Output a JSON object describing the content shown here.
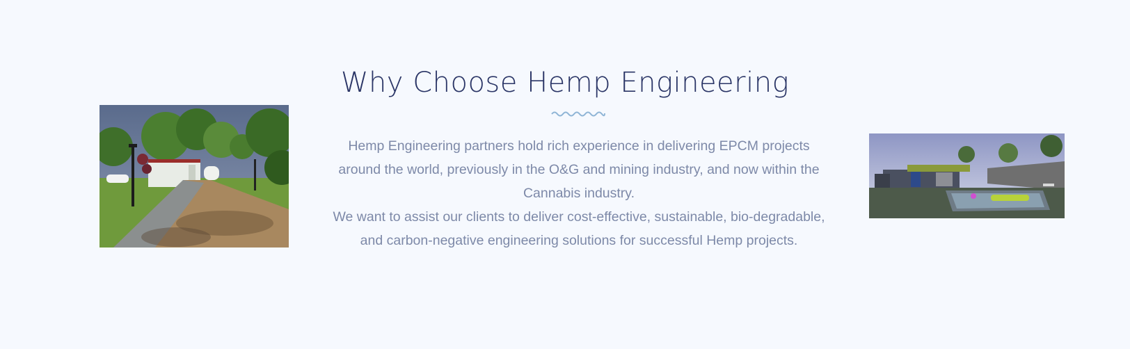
{
  "section": {
    "heading": "Why Choose Hemp Engineering",
    "paragraph_1": "Hemp Engineering partners hold rich experience in delivering EPCM projects around the world, previously in the O&G and mining industry, and now within the Cannabis industry.",
    "paragraph_2": "We want to assist our clients to deliver cost-effective, sustainable, bio-degradable, and carbon-negative engineering solutions for successful Hemp projects."
  },
  "images": {
    "left": "walkway-render-photo",
    "right": "pool-house-render-photo"
  },
  "colors": {
    "background": "#f6f9fe",
    "heading": "#2a3566",
    "body_text": "#7d89a8",
    "accent_wave": "#8fb5d6"
  }
}
